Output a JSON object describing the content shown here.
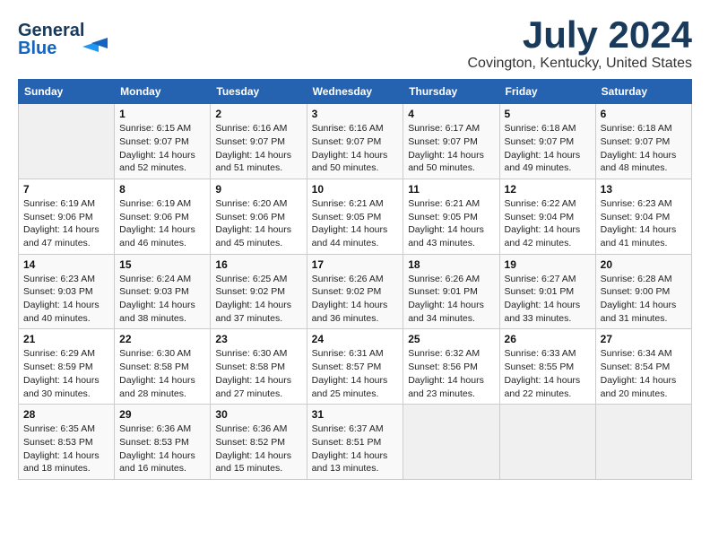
{
  "logo": {
    "line1": "General",
    "line2": "Blue"
  },
  "title": "July 2024",
  "subtitle": "Covington, Kentucky, United States",
  "weekdays": [
    "Sunday",
    "Monday",
    "Tuesday",
    "Wednesday",
    "Thursday",
    "Friday",
    "Saturday"
  ],
  "weeks": [
    [
      {
        "day": "",
        "info": ""
      },
      {
        "day": "1",
        "info": "Sunrise: 6:15 AM\nSunset: 9:07 PM\nDaylight: 14 hours\nand 52 minutes."
      },
      {
        "day": "2",
        "info": "Sunrise: 6:16 AM\nSunset: 9:07 PM\nDaylight: 14 hours\nand 51 minutes."
      },
      {
        "day": "3",
        "info": "Sunrise: 6:16 AM\nSunset: 9:07 PM\nDaylight: 14 hours\nand 50 minutes."
      },
      {
        "day": "4",
        "info": "Sunrise: 6:17 AM\nSunset: 9:07 PM\nDaylight: 14 hours\nand 50 minutes."
      },
      {
        "day": "5",
        "info": "Sunrise: 6:18 AM\nSunset: 9:07 PM\nDaylight: 14 hours\nand 49 minutes."
      },
      {
        "day": "6",
        "info": "Sunrise: 6:18 AM\nSunset: 9:07 PM\nDaylight: 14 hours\nand 48 minutes."
      }
    ],
    [
      {
        "day": "7",
        "info": "Sunrise: 6:19 AM\nSunset: 9:06 PM\nDaylight: 14 hours\nand 47 minutes."
      },
      {
        "day": "8",
        "info": "Sunrise: 6:19 AM\nSunset: 9:06 PM\nDaylight: 14 hours\nand 46 minutes."
      },
      {
        "day": "9",
        "info": "Sunrise: 6:20 AM\nSunset: 9:06 PM\nDaylight: 14 hours\nand 45 minutes."
      },
      {
        "day": "10",
        "info": "Sunrise: 6:21 AM\nSunset: 9:05 PM\nDaylight: 14 hours\nand 44 minutes."
      },
      {
        "day": "11",
        "info": "Sunrise: 6:21 AM\nSunset: 9:05 PM\nDaylight: 14 hours\nand 43 minutes."
      },
      {
        "day": "12",
        "info": "Sunrise: 6:22 AM\nSunset: 9:04 PM\nDaylight: 14 hours\nand 42 minutes."
      },
      {
        "day": "13",
        "info": "Sunrise: 6:23 AM\nSunset: 9:04 PM\nDaylight: 14 hours\nand 41 minutes."
      }
    ],
    [
      {
        "day": "14",
        "info": "Sunrise: 6:23 AM\nSunset: 9:03 PM\nDaylight: 14 hours\nand 40 minutes."
      },
      {
        "day": "15",
        "info": "Sunrise: 6:24 AM\nSunset: 9:03 PM\nDaylight: 14 hours\nand 38 minutes."
      },
      {
        "day": "16",
        "info": "Sunrise: 6:25 AM\nSunset: 9:02 PM\nDaylight: 14 hours\nand 37 minutes."
      },
      {
        "day": "17",
        "info": "Sunrise: 6:26 AM\nSunset: 9:02 PM\nDaylight: 14 hours\nand 36 minutes."
      },
      {
        "day": "18",
        "info": "Sunrise: 6:26 AM\nSunset: 9:01 PM\nDaylight: 14 hours\nand 34 minutes."
      },
      {
        "day": "19",
        "info": "Sunrise: 6:27 AM\nSunset: 9:01 PM\nDaylight: 14 hours\nand 33 minutes."
      },
      {
        "day": "20",
        "info": "Sunrise: 6:28 AM\nSunset: 9:00 PM\nDaylight: 14 hours\nand 31 minutes."
      }
    ],
    [
      {
        "day": "21",
        "info": "Sunrise: 6:29 AM\nSunset: 8:59 PM\nDaylight: 14 hours\nand 30 minutes."
      },
      {
        "day": "22",
        "info": "Sunrise: 6:30 AM\nSunset: 8:58 PM\nDaylight: 14 hours\nand 28 minutes."
      },
      {
        "day": "23",
        "info": "Sunrise: 6:30 AM\nSunset: 8:58 PM\nDaylight: 14 hours\nand 27 minutes."
      },
      {
        "day": "24",
        "info": "Sunrise: 6:31 AM\nSunset: 8:57 PM\nDaylight: 14 hours\nand 25 minutes."
      },
      {
        "day": "25",
        "info": "Sunrise: 6:32 AM\nSunset: 8:56 PM\nDaylight: 14 hours\nand 23 minutes."
      },
      {
        "day": "26",
        "info": "Sunrise: 6:33 AM\nSunset: 8:55 PM\nDaylight: 14 hours\nand 22 minutes."
      },
      {
        "day": "27",
        "info": "Sunrise: 6:34 AM\nSunset: 8:54 PM\nDaylight: 14 hours\nand 20 minutes."
      }
    ],
    [
      {
        "day": "28",
        "info": "Sunrise: 6:35 AM\nSunset: 8:53 PM\nDaylight: 14 hours\nand 18 minutes."
      },
      {
        "day": "29",
        "info": "Sunrise: 6:36 AM\nSunset: 8:53 PM\nDaylight: 14 hours\nand 16 minutes."
      },
      {
        "day": "30",
        "info": "Sunrise: 6:36 AM\nSunset: 8:52 PM\nDaylight: 14 hours\nand 15 minutes."
      },
      {
        "day": "31",
        "info": "Sunrise: 6:37 AM\nSunset: 8:51 PM\nDaylight: 14 hours\nand 13 minutes."
      },
      {
        "day": "",
        "info": ""
      },
      {
        "day": "",
        "info": ""
      },
      {
        "day": "",
        "info": ""
      }
    ]
  ]
}
